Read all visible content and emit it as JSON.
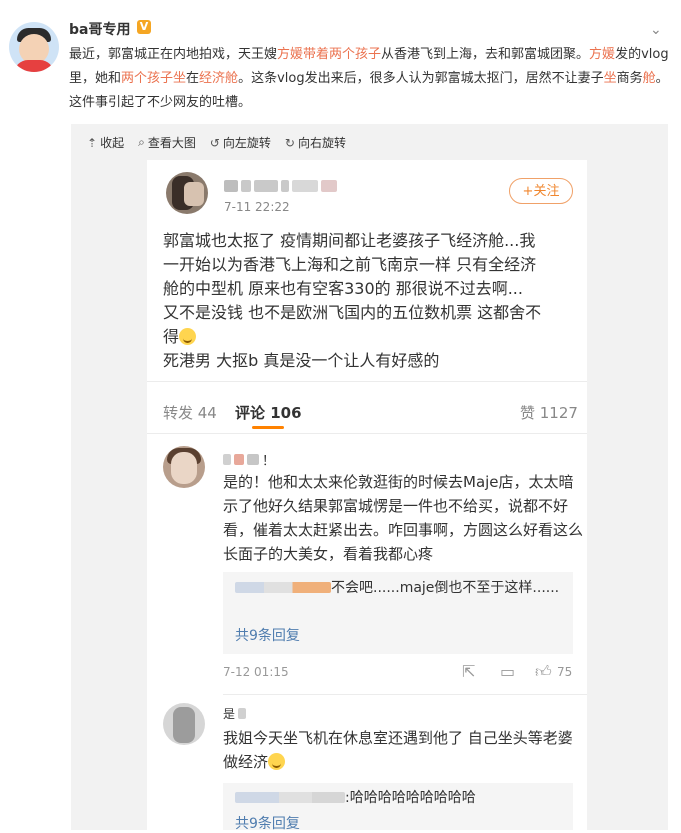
{
  "post": {
    "username": "ba哥专用",
    "verified_badge": "V",
    "text_parts": [
      {
        "t": "最近，郭富城正在内地拍戏，天王嫂",
        "hl": false
      },
      {
        "t": "方媛带着两个孩子",
        "hl": true
      },
      {
        "t": "从香港飞到上海，去和郭富城团聚。",
        "hl": false
      },
      {
        "t": "方媛",
        "hl": true
      },
      {
        "t": "发的vlog里，她和",
        "hl": false
      },
      {
        "t": "两个孩子坐",
        "hl": true
      },
      {
        "t": "在",
        "hl": false
      },
      {
        "t": "经济舱",
        "hl": true
      },
      {
        "t": "。这条vlog发出来后，很多人认为郭富城太抠门，居然不让妻子",
        "hl": false
      },
      {
        "t": "坐",
        "hl": true
      },
      {
        "t": "商务",
        "hl": false
      },
      {
        "t": "舱",
        "hl": true
      },
      {
        "t": "。这件事引起了不少网友的吐槽。",
        "hl": false
      }
    ],
    "highlight_color": "#eb7350"
  },
  "toolbar": {
    "collapse": "收起",
    "view_large": "查看大图",
    "rotate_left": "向左旋转",
    "rotate_right": "向右旋转"
  },
  "screenshot": {
    "post_time": "7-11 22:22",
    "follow_label": "+关注",
    "text_lines": [
      "郭富城也太抠了 疫情期间都让老婆孩子飞经济舱...我",
      "一开始以为香港飞上海和之前飞南京一样 只有全经济",
      "舱的中型机 原来也有空客330的 那很说不过去啊...",
      "又不是没钱 也不是欧洲飞国内的五位数机票 这都舍不",
      "得",
      "死港男 大抠b 真是没一个让人有好感的"
    ],
    "tabs": {
      "repost": "转发 44",
      "comment": "评论 106",
      "like": "赞 1127"
    },
    "comments": [
      {
        "name_suffix": "！",
        "text": "是的！他和太太来伦敦逛街的时候去Maje店，太太暗示了他好久结果郭富城愣是一件也不给买，说都不好看，催着太太赶紧出去。咋回事啊，方圆这么好看这么长面子的大美女，看着我都心疼",
        "reply_text": "不会吧......maje倒也不至于这样......",
        "more_replies": "共9条回复",
        "time": "7-12 01:15",
        "likes": "75"
      },
      {
        "name_prefix": "是",
        "text": "我姐今天坐飞机在休息室还遇到他了 自己坐头等老婆做经济",
        "reply_text": "哈哈哈哈哈哈哈哈哈",
        "more_replies": "共9条回复"
      }
    ]
  },
  "colors": {
    "follow": "#f0862e",
    "tab_accent": "#ff8200",
    "link": "#507daf"
  }
}
